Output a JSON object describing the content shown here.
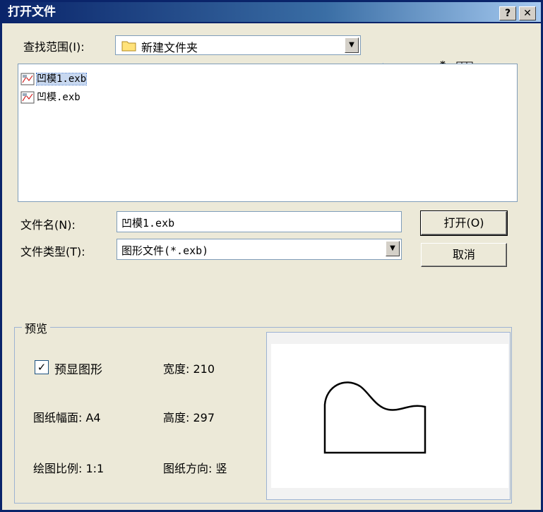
{
  "window": {
    "title": "打开文件",
    "help_btn": "?",
    "close_btn": "✕"
  },
  "lookin": {
    "label": "查找范围(I):",
    "folder": "新建文件夹"
  },
  "files": [
    {
      "name": "凹模1.exb",
      "selected": true
    },
    {
      "name": "凹模.exb",
      "selected": false
    }
  ],
  "filename": {
    "label": "文件名(N):",
    "value": "凹模1.exb"
  },
  "filetype": {
    "label": "文件类型(T):",
    "value": "图形文件(*.exb)"
  },
  "buttons": {
    "open": "打开(O)",
    "cancel": "取消"
  },
  "preview": {
    "legend": "预览",
    "checkbox_label": "预显图形",
    "checked": true,
    "width": "宽度: 210",
    "height": "高度: 297",
    "sheet": "图纸幅面: A4",
    "orientation": "图纸方向: 竖",
    "scale": "绘图比例: 1:1"
  },
  "colors": {
    "title_start": "#0a246a",
    "title_end": "#a6caf0",
    "dialog_bg": "#ece9d8",
    "selection": "#c8d8f0"
  }
}
